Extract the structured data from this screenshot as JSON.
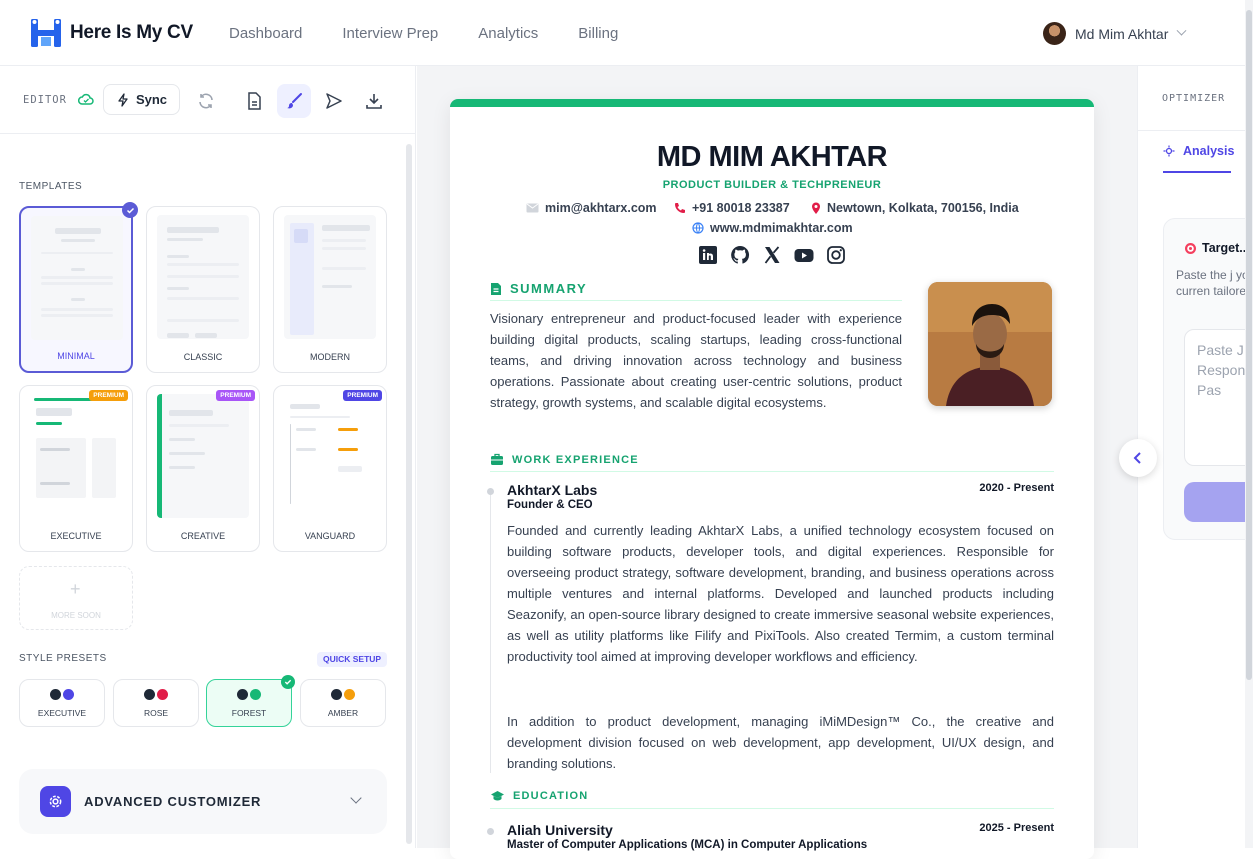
{
  "app": {
    "name": "Here Is My CV"
  },
  "nav": [
    "Dashboard",
    "Interview Prep",
    "Analytics",
    "Billing"
  ],
  "user": {
    "name": "Md Mim Akhtar"
  },
  "editor": {
    "label": "EDITOR",
    "sync_label": "Sync",
    "templates_title": "TEMPLATES",
    "templates": [
      {
        "name": "MINIMAL",
        "selected": true
      },
      {
        "name": "CLASSIC"
      },
      {
        "name": "MODERN"
      },
      {
        "name": "EXECUTIVE",
        "badge": "PREMIUM"
      },
      {
        "name": "CREATIVE",
        "badge": "PREMIUM"
      },
      {
        "name": "VANGUARD",
        "badge": "PREMIUM"
      }
    ],
    "more_soon": "MORE SOON",
    "style_presets_title": "STYLE PRESETS",
    "quick_setup": "QUICK SETUP",
    "presets": [
      {
        "name": "EXECUTIVE",
        "c1": "#1f2937",
        "c2": "#4f46e5"
      },
      {
        "name": "ROSE",
        "c1": "#1f2937",
        "c2": "#e11d48"
      },
      {
        "name": "FOREST",
        "c1": "#1f2937",
        "c2": "#16b876",
        "selected": true
      },
      {
        "name": "AMBER",
        "c1": "#1f2937",
        "c2": "#f59e0b"
      }
    ],
    "advanced": "ADVANCED CUSTOMIZER"
  },
  "cv": {
    "name": "MD MIM AKHTAR",
    "title": "PRODUCT BUILDER & TECHPRENEUR",
    "email": "mim@akhtarx.com",
    "phone": "+91 80018 23387",
    "location": "Newtown, Kolkata, 700156, India",
    "website": "www.mdmimakhtar.com",
    "summary_heading": "SUMMARY",
    "summary": "Visionary entrepreneur and product-focused leader with experience building digital products, scaling startups, leading cross-functional teams, and driving innovation across technology and business operations. Passionate about creating user-centric solutions, product strategy, growth systems, and scalable digital ecosystems.",
    "work_heading": "WORK EXPERIENCE",
    "work": {
      "company": "AkhtarX Labs",
      "role": "Founder & CEO",
      "dates": "2020 - Present",
      "p1": "Founded and currently leading AkhtarX Labs, a unified technology ecosystem focused on building software products, developer tools, and digital experiences. Responsible for overseeing product strategy, software development, branding, and business operations across multiple ventures and internal platforms. Developed and launched products including Seazonify, an open-source library designed to create immersive seasonal website experiences, as well as utility platforms like Filify and PixiTools. Also created Termim, a custom terminal productivity tool aimed at improving developer workflows and efficiency.",
      "p2": "In addition to product development, managing iMiMDesign™ Co., the creative and development division focused on web development, app development, UI/UX design, and branding solutions."
    },
    "edu_heading": "EDUCATION",
    "edu": {
      "school": "Aliah University",
      "degree": "Master of Computer Applications (MCA) in Computer Applications",
      "dates": "2025 - Present"
    }
  },
  "optimizer": {
    "label": "OPTIMIZER",
    "tab": "Analysis",
    "card_title": "Target...",
    "card_desc": "Paste the j your curren tailored su",
    "placeholder": "Paste J Respon Pro Pas"
  }
}
